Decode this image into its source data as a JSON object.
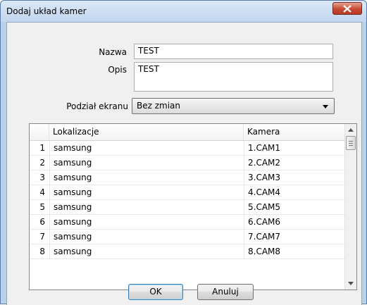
{
  "window": {
    "title": "Dodaj układ kamer"
  },
  "form": {
    "name_label": "Nazwa",
    "name_value": "TEST",
    "desc_label": "Opis",
    "desc_value": "TEST",
    "split_label": "Podział ekranu",
    "split_value": "Bez zmian"
  },
  "table": {
    "headers": {
      "number": "",
      "location": "Lokalizacje",
      "camera": "Kamera"
    },
    "rows": [
      {
        "num": "1",
        "location": "samsung",
        "camera": "1.CAM1"
      },
      {
        "num": "2",
        "location": "samsung",
        "camera": "2.CAM2"
      },
      {
        "num": "3",
        "location": "samsung",
        "camera": "3.CAM3"
      },
      {
        "num": "4",
        "location": "samsung",
        "camera": "4.CAM4"
      },
      {
        "num": "5",
        "location": "samsung",
        "camera": "5.CAM5"
      },
      {
        "num": "6",
        "location": "samsung",
        "camera": "6.CAM6"
      },
      {
        "num": "7",
        "location": "samsung",
        "camera": "7.CAM7"
      },
      {
        "num": "8",
        "location": "samsung",
        "camera": "8.CAM8"
      }
    ]
  },
  "buttons": {
    "ok": "OK",
    "cancel": "Anuluj"
  },
  "icons": {
    "close": "close-icon",
    "dropdown": "chevron-down-icon",
    "scroll_up": "arrow-up-icon",
    "scroll_down": "arrow-down-icon"
  },
  "colors": {
    "close_button": "#c74a34",
    "titlebar": "#c2d6ee",
    "dialog_bg": "#f0f0f0",
    "default_button_border": "#3c7fb1"
  }
}
